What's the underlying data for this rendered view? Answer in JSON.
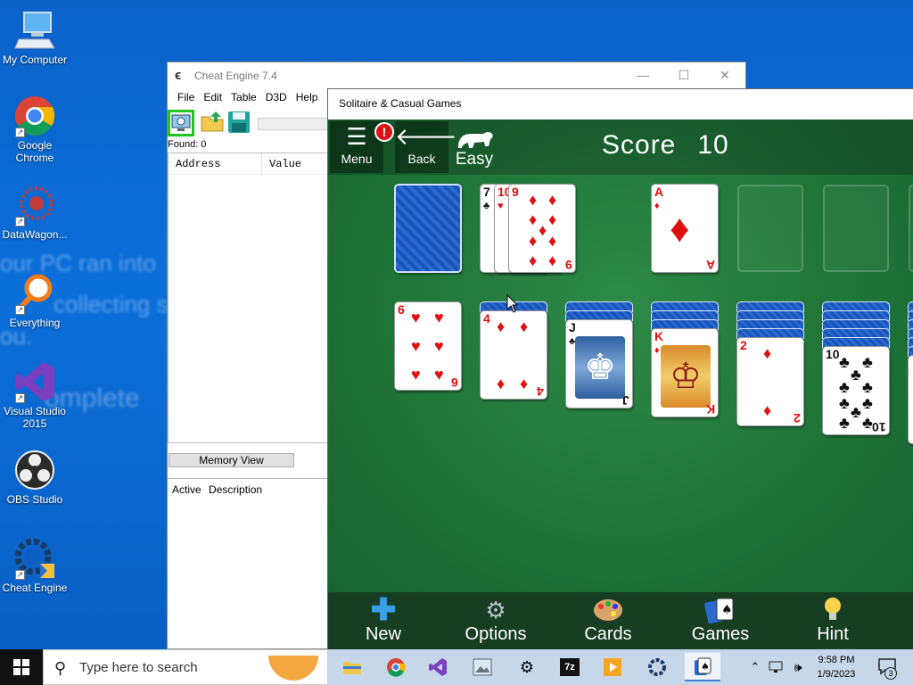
{
  "desktop": {
    "icons": [
      {
        "label": "My Computer",
        "icon": "computer-icon"
      },
      {
        "label": "Google Chrome",
        "icon": "chrome-icon"
      },
      {
        "label": "DataWagon...",
        "icon": "datawagon-icon"
      },
      {
        "label": "Everything",
        "icon": "everything-search-icon"
      },
      {
        "label": "Visual Studio 2015",
        "icon": "visual-studio-icon"
      },
      {
        "label": "OBS Studio",
        "icon": "obs-icon"
      },
      {
        "label": "Cheat Engine",
        "icon": "cheat-engine-icon"
      }
    ],
    "wallpaper_text": [
      "our PC ran into",
      "collecting so",
      "ou.",
      "omplete"
    ]
  },
  "cheat_engine": {
    "title": "Cheat Engine 7.4",
    "menu": [
      "File",
      "Edit",
      "Table",
      "D3D",
      "Help"
    ],
    "toolbar": {
      "open_process": "select-process-icon",
      "open": "open-folder-icon",
      "save": "save-icon"
    },
    "found_label": "Found: 0",
    "columns": [
      "Address",
      "Value"
    ],
    "memory_view": "Memory View",
    "table_columns": [
      "Active",
      "Description"
    ]
  },
  "solitaire": {
    "title": "Solitaire & Casual Games",
    "menu_label": "Menu",
    "menu_badge": "!",
    "back_label": "Back",
    "difficulty": "Easy",
    "score_label": "Score",
    "score_value": "10",
    "stock": {
      "face_down": true
    },
    "waste": [
      {
        "rank": "7",
        "suit": "♣",
        "color": "black"
      },
      {
        "rank": "10",
        "suit": "♥",
        "color": "red"
      },
      {
        "rank": "9",
        "suit": "♦",
        "color": "red"
      }
    ],
    "foundations": [
      {
        "rank": "A",
        "suit": "♦",
        "color": "red"
      },
      null,
      null,
      null
    ],
    "tableau": [
      {
        "hidden": 0,
        "top": {
          "rank": "6",
          "suit": "♥",
          "color": "red"
        }
      },
      {
        "hidden": 1,
        "top": {
          "rank": "4",
          "suit": "♦",
          "color": "red"
        }
      },
      {
        "hidden": 2,
        "top": {
          "rank": "J",
          "suit": "♣",
          "color": "black"
        }
      },
      {
        "hidden": 3,
        "top": {
          "rank": "K",
          "suit": "♦",
          "color": "red"
        }
      },
      {
        "hidden": 4,
        "top": {
          "rank": "2",
          "suit": "♦",
          "color": "red"
        }
      },
      {
        "hidden": 5,
        "top": {
          "rank": "10",
          "suit": "♣",
          "color": "black"
        }
      }
    ],
    "bottom_bar": [
      {
        "label": "New",
        "icon": "plus-icon"
      },
      {
        "label": "Options",
        "icon": "gear-icon"
      },
      {
        "label": "Cards",
        "icon": "palette-icon"
      },
      {
        "label": "Games",
        "icon": "cards-icon"
      },
      {
        "label": "Hint",
        "icon": "lightbulb-icon"
      }
    ]
  },
  "taskbar": {
    "search_placeholder": "Type here to search",
    "apps": [
      "file-explorer-icon",
      "chrome-icon",
      "visual-studio-icon",
      "photos-icon",
      "settings-icon",
      "7zip-icon",
      "media-player-icon",
      "cheat-engine-icon",
      "solitaire-icon"
    ],
    "time": "9:58 PM",
    "date": "1/9/2023",
    "notifications": "3"
  },
  "colors": {
    "felt": "#1f7438",
    "desktop": "#0a6cd6",
    "highlight": "#22c422"
  }
}
